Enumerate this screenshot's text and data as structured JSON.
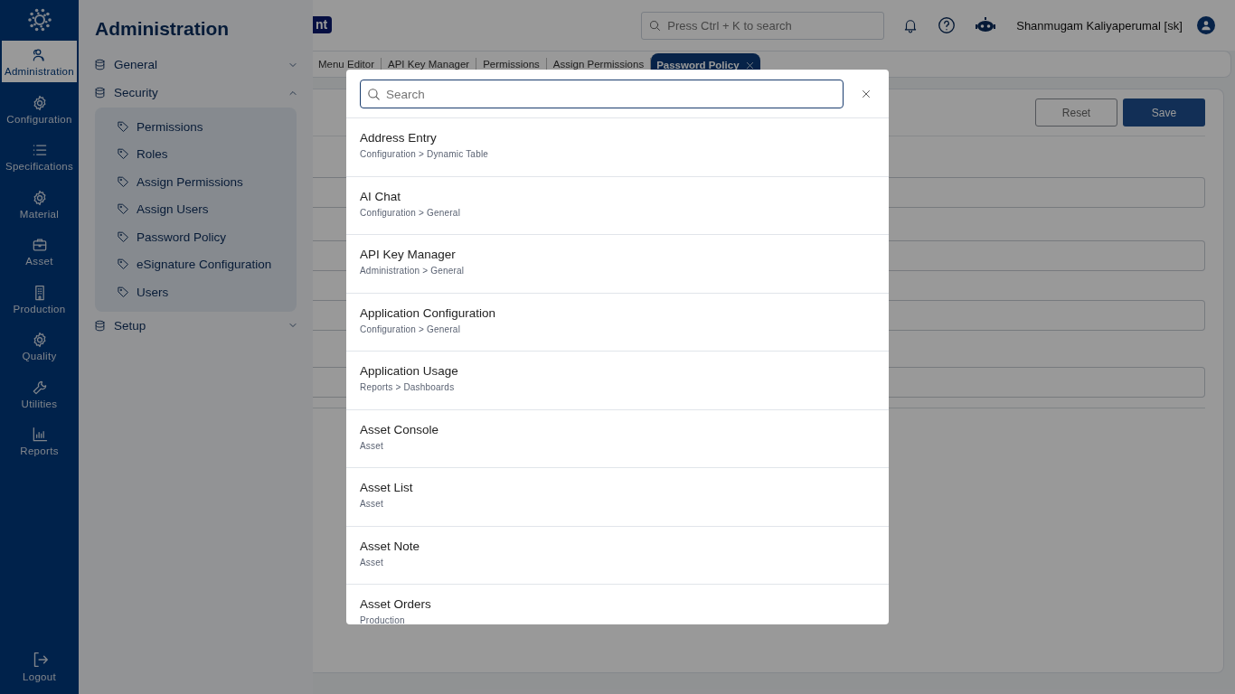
{
  "rail": {
    "items": [
      {
        "label": "Administration",
        "selected": true
      },
      {
        "label": "Configuration",
        "selected": false
      },
      {
        "label": "Specifications",
        "selected": false
      },
      {
        "label": "Material",
        "selected": false
      },
      {
        "label": "Asset",
        "selected": false
      },
      {
        "label": "Production",
        "selected": false
      },
      {
        "label": "Quality",
        "selected": false
      },
      {
        "label": "Utilities",
        "selected": false
      },
      {
        "label": "Reports",
        "selected": false
      }
    ],
    "logout": "Logout"
  },
  "nav": {
    "title": "Administration",
    "groups": [
      {
        "label": "General",
        "expanded": false
      },
      {
        "label": "Security",
        "expanded": true,
        "children": [
          {
            "label": "Permissions"
          },
          {
            "label": "Roles"
          },
          {
            "label": "Assign Permissions"
          },
          {
            "label": "Assign Users"
          },
          {
            "label": "Password Policy"
          },
          {
            "label": "eSignature Configuration"
          },
          {
            "label": "Users"
          }
        ]
      },
      {
        "label": "Setup",
        "expanded": false
      }
    ]
  },
  "header": {
    "badge": "nt",
    "search_placeholder": "Press Ctrl + K to search",
    "user": "Shanmugam Kaliyaperumal [sk]"
  },
  "tabs": [
    {
      "label": "Menu Editor",
      "selected": false
    },
    {
      "label": "API Key Manager",
      "selected": false
    },
    {
      "label": "Permissions",
      "selected": false
    },
    {
      "label": "Assign Permissions",
      "selected": false
    },
    {
      "label": "Password Policy",
      "selected": true
    }
  ],
  "form": {
    "buttons": [
      {
        "label": "Reset",
        "kind": "secondary"
      },
      {
        "label": "Save",
        "kind": "primary"
      }
    ],
    "fields": [
      {
        "kind": "text"
      },
      {
        "kind": "text"
      },
      {
        "kind": "text"
      },
      {
        "kind": "text"
      }
    ]
  },
  "search_dialog": {
    "placeholder": "Search",
    "results": [
      {
        "title": "Address Entry",
        "path": "Configuration > Dynamic Table"
      },
      {
        "title": "AI Chat",
        "path": "Configuration > General"
      },
      {
        "title": "API Key Manager",
        "path": "Administration > General"
      },
      {
        "title": "Application Configuration",
        "path": "Configuration > General"
      },
      {
        "title": "Application Usage",
        "path": "Reports > Dashboards"
      },
      {
        "title": "Asset Console",
        "path": "Asset"
      },
      {
        "title": "Asset List",
        "path": "Asset"
      },
      {
        "title": "Asset Note",
        "path": "Asset"
      },
      {
        "title": "Asset Orders",
        "path": "Production"
      }
    ]
  }
}
